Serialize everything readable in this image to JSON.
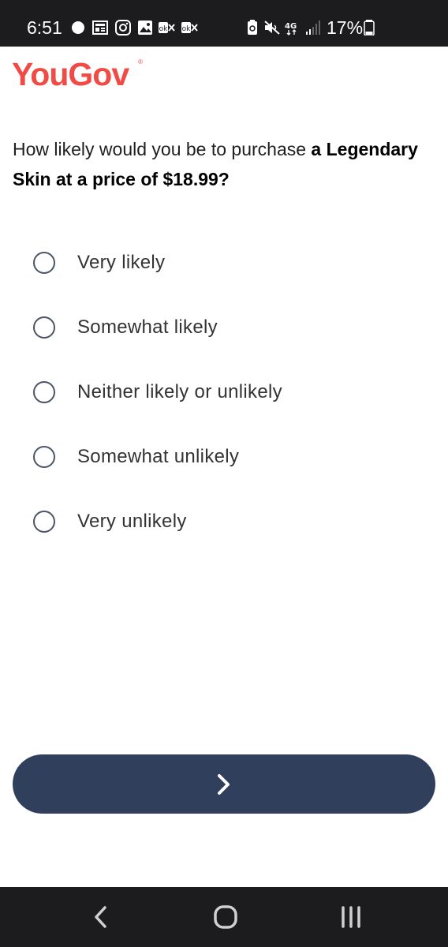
{
  "status_bar": {
    "time": "6:51",
    "battery_percent": "17%",
    "network": "4G",
    "left_icons": [
      "signal-app-icon",
      "news-icon",
      "instagram-icon",
      "gallery-icon",
      "ok-icon",
      "ok-icon"
    ],
    "right_icons": [
      "battery-saver-icon",
      "mute-icon",
      "4g-icon",
      "signal-bars-icon",
      "battery-icon"
    ]
  },
  "brand": {
    "logo_text": "YouGov",
    "logo_mark": "®",
    "color": "#f04b44"
  },
  "question": {
    "text_regular": "How likely would you be to purchase ",
    "text_bold": "a Legendary Skin at a price of $18.99?"
  },
  "options": [
    {
      "label": "Very likely",
      "selected": false
    },
    {
      "label": "Somewhat likely",
      "selected": false
    },
    {
      "label": "Neither likely or unlikely",
      "selected": false
    },
    {
      "label": "Somewhat unlikely",
      "selected": false
    },
    {
      "label": "Very unlikely",
      "selected": false
    }
  ],
  "next_button": {
    "icon": "chevron-right-icon",
    "color": "#303f5c"
  },
  "nav_bar": {
    "buttons": [
      "back-icon",
      "home-icon",
      "recents-icon"
    ]
  }
}
